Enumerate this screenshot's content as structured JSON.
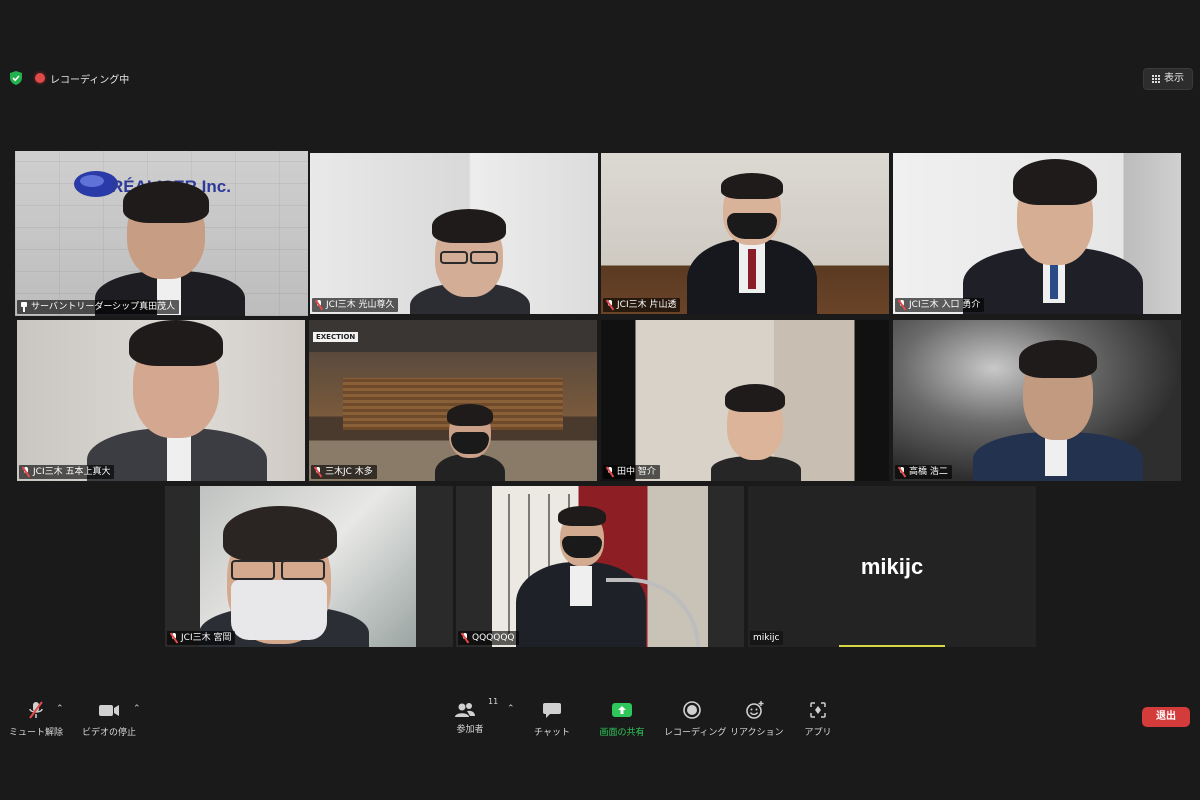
{
  "status": {
    "recording_text": "レコーディング中",
    "view_label": "表示"
  },
  "participants": [
    {
      "name": "サーバントリーダーシップ真田茂人"
    },
    {
      "name": "JCI三木 光山尊久"
    },
    {
      "name": "JCI三木 片山透"
    },
    {
      "name": "JCI三木 入口 勇介"
    },
    {
      "name": "JCI三木 五本上真大"
    },
    {
      "name": "三木JC 木多"
    },
    {
      "name": "田中 智介"
    },
    {
      "name": "高橋 浩二"
    },
    {
      "name": "JCI三木 宮岡"
    },
    {
      "name": "QQQQQQ"
    },
    {
      "name": "mikijc",
      "display_name": "mikijc"
    }
  ],
  "scene_text": {
    "company_logo": "RÉALISER Inc.",
    "cafe_sign": "EXECTION"
  },
  "toolbar": {
    "unmute": "ミュート解除",
    "stop_video": "ビデオの停止",
    "participants": "参加者",
    "participants_count": "11",
    "chat": "チャット",
    "share_screen": "画面の共有",
    "recording": "レコーディング",
    "reactions": "リアクション",
    "apps": "アプリ",
    "leave": "退出"
  },
  "colors": {
    "active_speaker": "#c8d94a",
    "share_green": "#2fc65a",
    "leave_red": "#d43b3b",
    "recording_red": "#e24a4a"
  }
}
